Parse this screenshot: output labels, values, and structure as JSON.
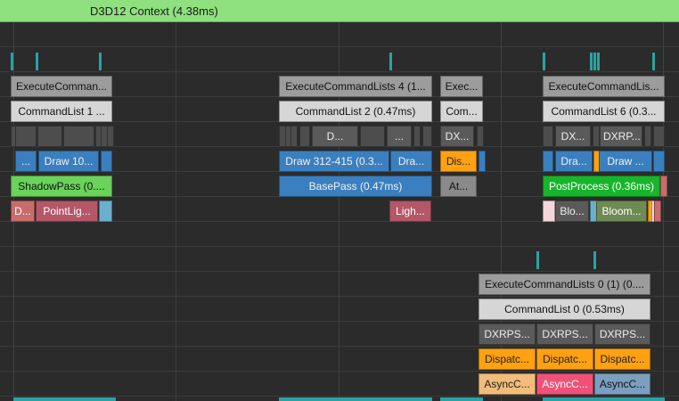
{
  "header": {
    "title": "D3D12 Context (4.38ms)"
  },
  "colors": {
    "header_bg": "#8fe07f",
    "marker": "#29a3a3",
    "blue": "#3a7fbf",
    "orange": "#ffa110",
    "green": "#69d35a",
    "green_dark": "#17b52b"
  },
  "graphics_queue": {
    "execute_command_lists": [
      "ExecuteComman...",
      "ExecuteCommandLists 4 (1...",
      "Exec...",
      "ExecuteCommandLis..."
    ],
    "command_lists": [
      "CommandList 1 ...",
      "CommandList 2 (0.47ms)",
      "Com...",
      "CommandList 6 (0.3..."
    ],
    "events": [
      "D...",
      "...",
      "DX...",
      "DX...",
      "DXRP..."
    ],
    "draws": [
      "...",
      "Draw 10...",
      "Draw 312-415 (0.3...",
      "Dra...",
      "Dis...",
      "Dra...",
      "Draw ..."
    ],
    "passes": [
      "ShadowPass (0....",
      "BasePass (0.47ms)",
      "At...",
      "PostProcess (0.36ms)"
    ],
    "subpasses": [
      "D...",
      "PointLig...",
      "Ligh...",
      "Blo...",
      "Bloom..."
    ]
  },
  "async_queue": {
    "execute_command_lists": "ExecuteCommandLists 0 (1) (0....",
    "command_list": "CommandList 0 (0.53ms)",
    "events": [
      "DXRPS...",
      "DXRPS...",
      "DXRPS..."
    ],
    "dispatches": [
      "Dispatc...",
      "Dispatc...",
      "Dispatc..."
    ],
    "async_compute": [
      "AsyncC...",
      "AsyncC...",
      "AsyncC..."
    ]
  }
}
